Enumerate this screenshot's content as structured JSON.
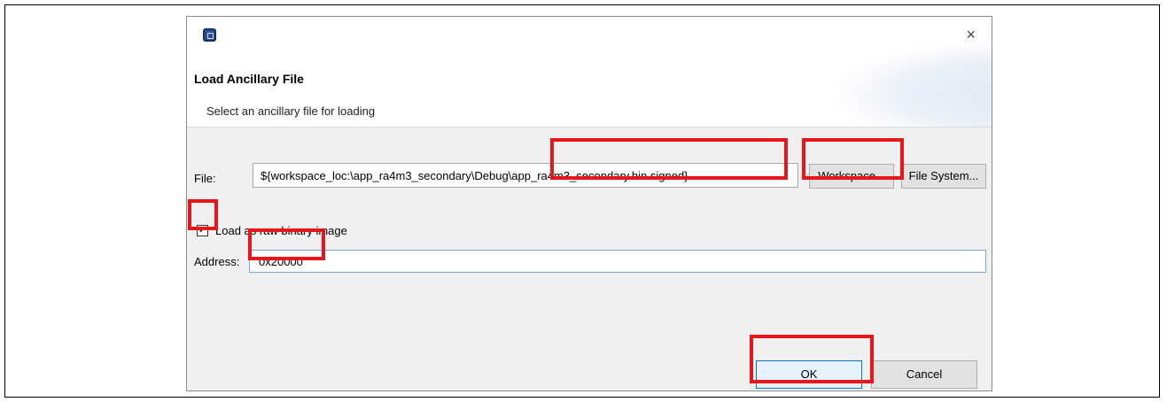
{
  "dialog": {
    "close_glyph": "×",
    "title": "Load Ancillary File",
    "subtitle": "Select an ancillary file for loading",
    "file_label": "File:",
    "file_value": "${workspace_loc:\\app_ra4m3_secondary\\Debug\\app_ra4m3_secondary.bin.signed}",
    "dropdown_glyph": "⌵",
    "workspace_button": "Workspace...",
    "filesystem_button": "File System...",
    "checkbox_checked_glyph": "✓",
    "checkbox_label": "Load as raw binary image",
    "address_label": "Address:",
    "address_value": "0x20000",
    "ok_button": "OK",
    "cancel_button": "Cancel"
  },
  "annotation_color": "#e8151b",
  "icons": [
    "app-icon",
    "close-icon",
    "dropdown-arrow-icon",
    "checkmark-icon"
  ]
}
